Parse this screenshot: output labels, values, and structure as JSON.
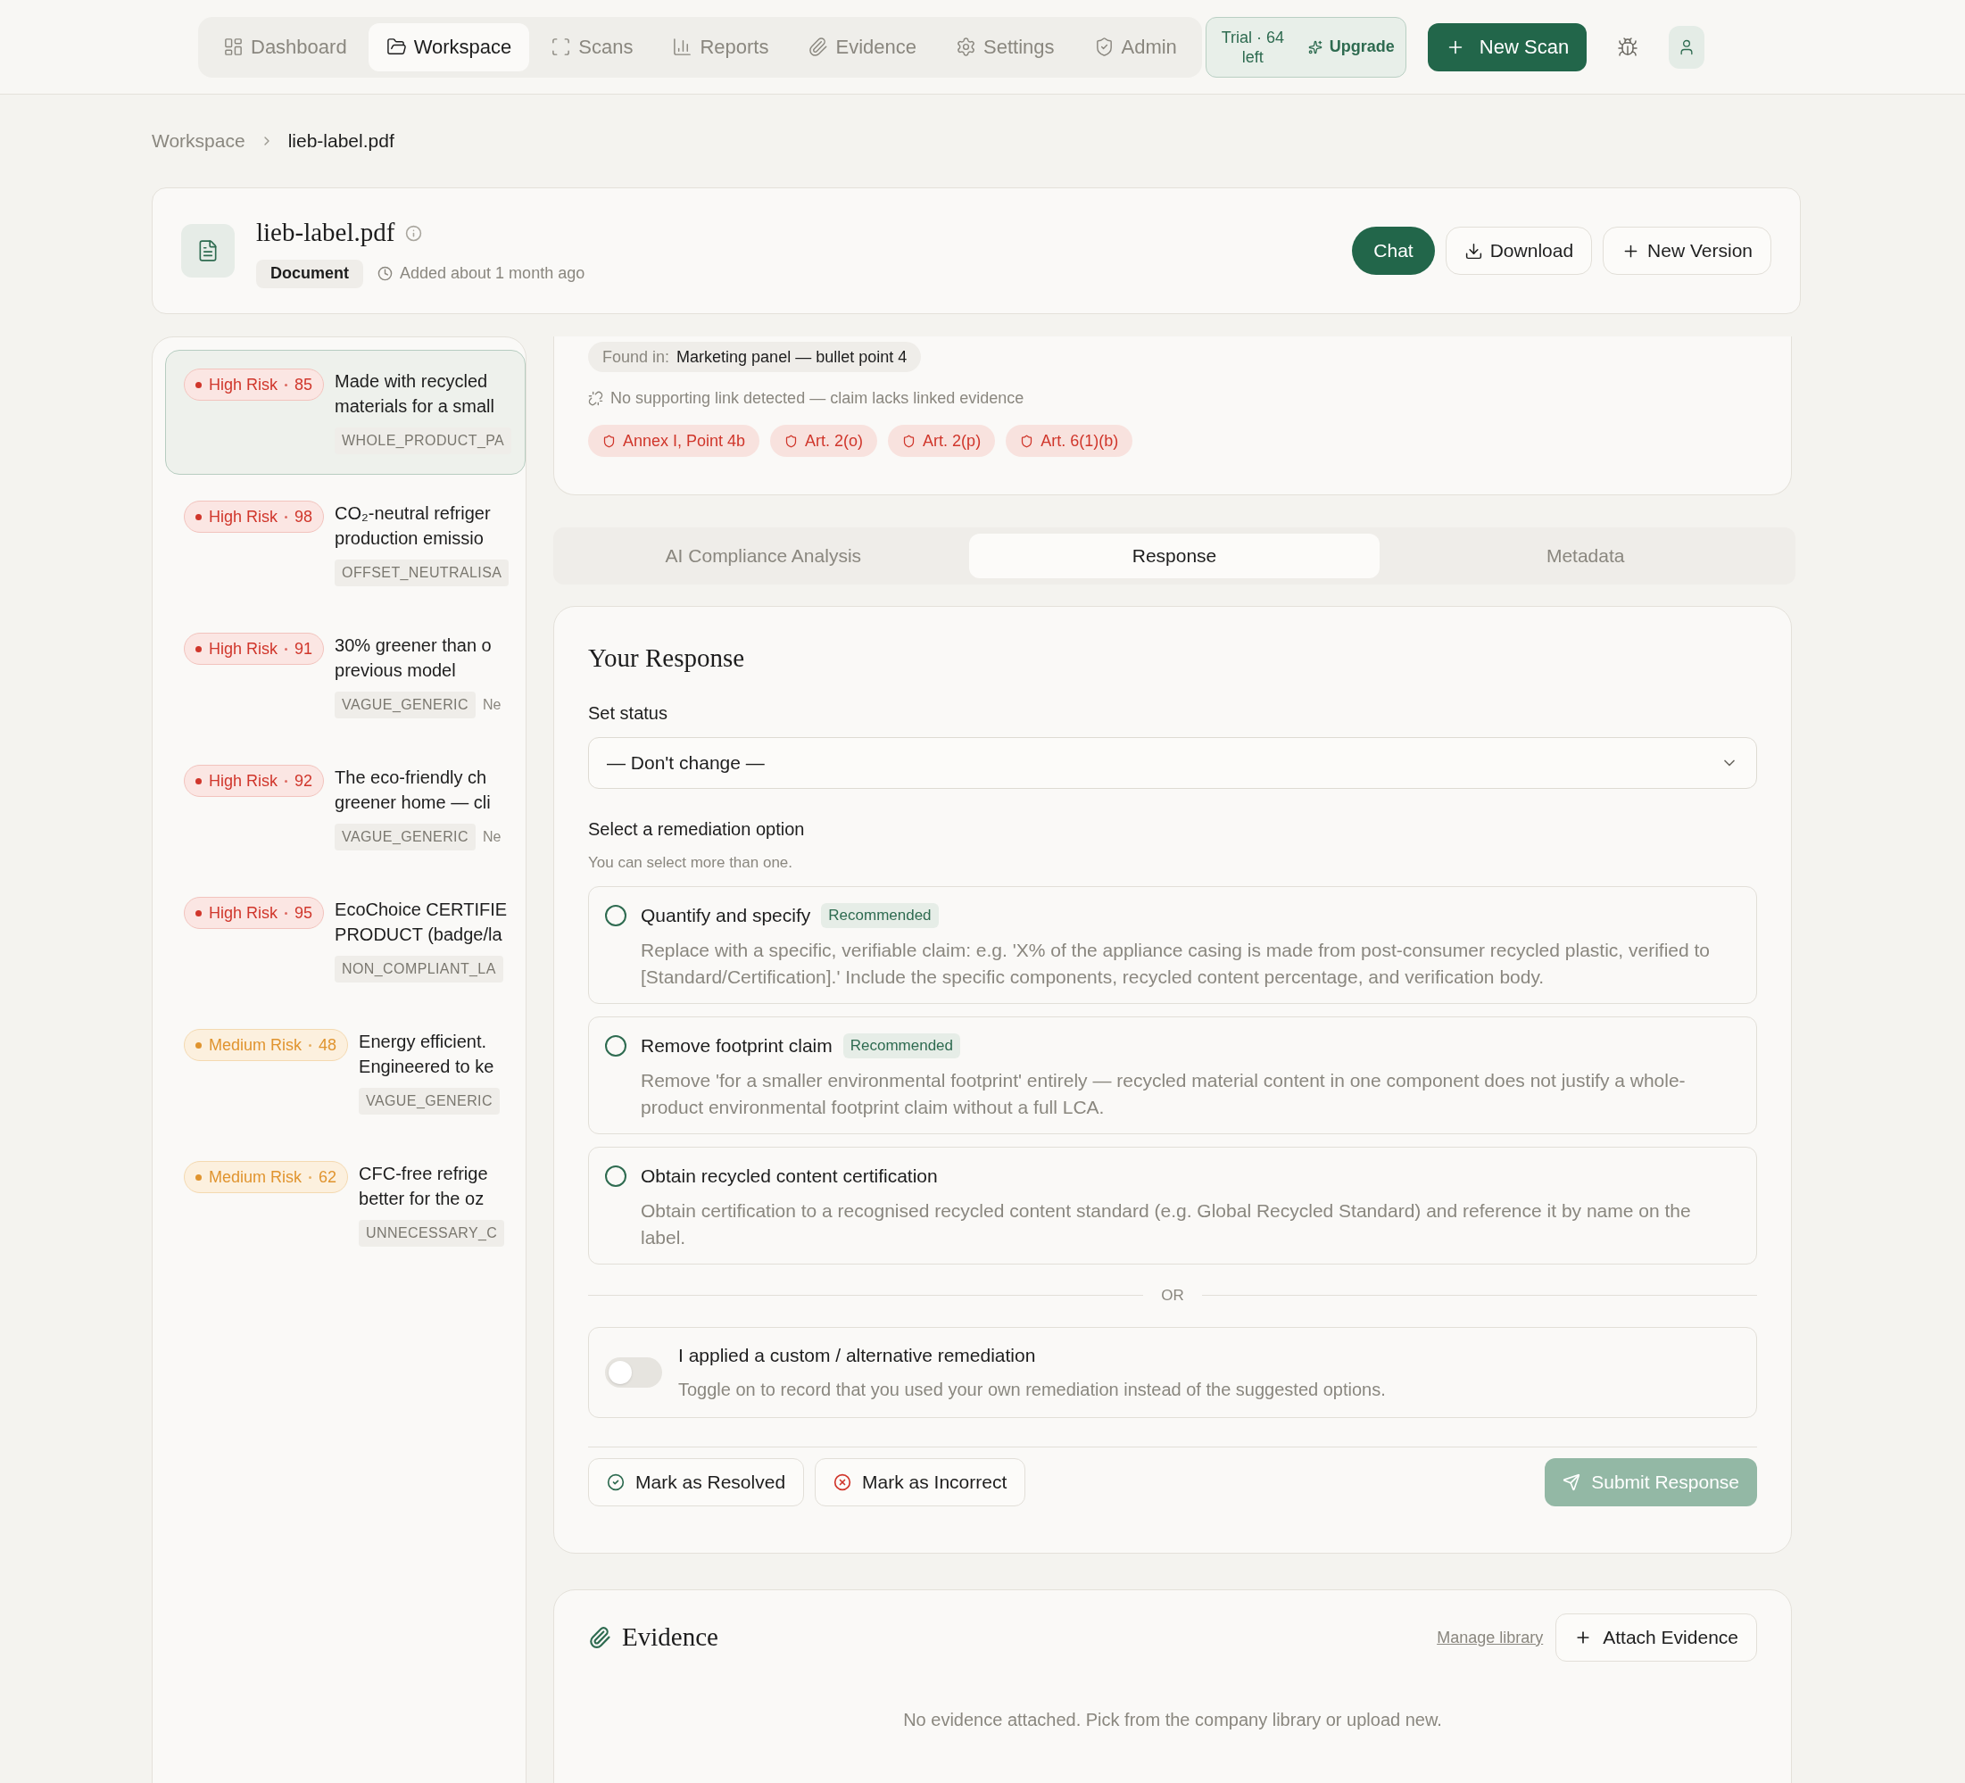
{
  "nav": {
    "tabs": [
      {
        "label": "Dashboard",
        "selected": false
      },
      {
        "label": "Workspace",
        "selected": true
      },
      {
        "label": "Scans",
        "selected": false
      },
      {
        "label": "Reports",
        "selected": false
      },
      {
        "label": "Evidence",
        "selected": false
      },
      {
        "label": "Settings",
        "selected": false
      },
      {
        "label": "Admin",
        "selected": false
      }
    ],
    "trial": "Trial · 64 left",
    "upgrade": "Upgrade",
    "new_scan": "New Scan"
  },
  "breadcrumb": [
    "Workspace",
    "lieb-label.pdf"
  ],
  "document": {
    "title": "lieb-label.pdf",
    "type": "Document",
    "added": "Added about 1 month ago",
    "actions": [
      {
        "label": "Chat",
        "kind": "primary"
      },
      {
        "label": "Download",
        "kind": "download"
      },
      {
        "label": "New Version",
        "kind": "add"
      }
    ]
  },
  "claims": [
    {
      "risk": "High Risk",
      "kind": "high",
      "score": "85",
      "lines": [
        "Made with recycled",
        "materials for a small"
      ],
      "tags": [
        "WHOLE_PRODUCT_PA"
      ],
      "selected": true
    },
    {
      "risk": "High Risk",
      "kind": "high",
      "score": "98",
      "lines": [
        "CO₂-neutral refriger",
        "production emissio"
      ],
      "tags": [
        "OFFSET_NEUTRALISA"
      ],
      "selected": false
    },
    {
      "risk": "High Risk",
      "kind": "high",
      "score": "91",
      "lines": [
        "30% greener than o",
        "previous model"
      ],
      "tags": [
        "VAGUE_GENERIC"
      ],
      "extra": "Ne",
      "selected": false
    },
    {
      "risk": "High Risk",
      "kind": "high",
      "score": "92",
      "lines": [
        "The eco-friendly ch",
        "greener home — cli"
      ],
      "tags": [
        "VAGUE_GENERIC"
      ],
      "extra": "Ne",
      "selected": false
    },
    {
      "risk": "High Risk",
      "kind": "high",
      "score": "95",
      "lines": [
        "EcoChoice CERTIFIE",
        "PRODUCT (badge/la"
      ],
      "tags": [
        "NON_COMPLIANT_LA"
      ],
      "selected": false
    },
    {
      "risk": "Medium Risk",
      "kind": "medium",
      "score": "48",
      "lines": [
        "Energy efficient.",
        "Engineered to ke"
      ],
      "tags": [
        "VAGUE_GENERIC"
      ],
      "selected": false
    },
    {
      "risk": "Medium Risk",
      "kind": "medium",
      "score": "62",
      "lines": [
        "CFC-free refrige",
        "better for the oz"
      ],
      "tags": [
        "UNNECESSARY_C"
      ],
      "selected": false
    }
  ],
  "claim_detail": {
    "found_in_label": "Found in:",
    "found_in": "Marketing panel — bullet point 4",
    "link_note": "No supporting link detected — claim lacks linked evidence",
    "articles": [
      "Annex I, Point 4b",
      "Art. 2(o)",
      "Art. 2(p)",
      "Art. 6(1)(b)"
    ]
  },
  "tabs": [
    {
      "label": "AI Compliance Analysis",
      "selected": false
    },
    {
      "label": "Response",
      "selected": true
    },
    {
      "label": "Metadata",
      "selected": false
    }
  ],
  "response": {
    "title": "Your Response",
    "status_label": "Set status",
    "status_value": "— Don't change —",
    "remediation_label": "Select a remediation option",
    "remediation_hint": "You can select more than one.",
    "options": [
      {
        "title": "Quantify and specify",
        "badge": "Recommended",
        "checked": false,
        "description": "Replace with a specific, verifiable claim: e.g. 'X% of the appliance casing is made from post-consumer recycled plastic, verified to [Standard/Certification].' Include the specific components, recycled content percentage, and verification body."
      },
      {
        "title": "Remove footprint claim",
        "badge": "Recommended",
        "checked": false,
        "description": "Remove 'for a smaller environmental footprint' entirely — recycled material content in one component does not justify a whole-product environmental footprint claim without a full LCA."
      },
      {
        "title": "Obtain recycled content certification",
        "checked": false,
        "description": "Obtain certification to a recognised recycled content standard (e.g. Global Recycled Standard) and reference it by name on the label."
      }
    ],
    "divider": "OR",
    "custom": {
      "title": "I applied a custom / alternative remediation",
      "description": "Toggle on to record that you used your own remediation instead of the suggested options.",
      "on": false
    },
    "actions": [
      {
        "label": "Mark as Resolved",
        "kind": "resolve"
      },
      {
        "label": "Mark as Incorrect",
        "kind": "incorrect"
      }
    ],
    "submit": {
      "label": "Submit Response",
      "disabled": true
    }
  },
  "evidence": {
    "title": "Evidence",
    "manage_link": "Manage library",
    "attach": "Attach Evidence",
    "empty": "No evidence attached. Pick from the company library or upload new."
  }
}
